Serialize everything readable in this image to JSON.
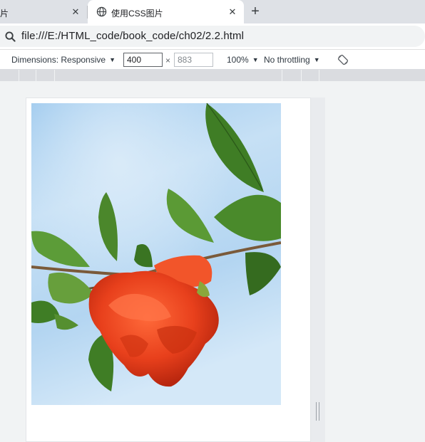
{
  "tabs": {
    "previous": {
      "title": "片"
    },
    "active": {
      "title": "使用CSS图片"
    }
  },
  "address_bar": {
    "url": "file:///E:/HTML_code/book_code/ch02/2.2.html"
  },
  "device_toolbar": {
    "dimensions_label": "Dimensions: Responsive",
    "width_value": "400",
    "times_sign": "×",
    "height_placeholder": "883",
    "zoom": "100%",
    "throttling": "No throttling"
  },
  "page": {
    "image_description_icon": "pomegranate-flower-photo"
  },
  "colors": {
    "tab_strip": "#dee1e6",
    "sky": "#a9cfee",
    "flower": "#e8401c",
    "leaf": "#3f7d25"
  }
}
